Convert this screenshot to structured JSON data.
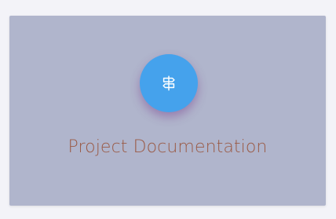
{
  "card": {
    "title": "Project Documentation",
    "icon": "signpost-icon",
    "background_color": "#b0b5cc",
    "icon_bg_color": "#45a2ec",
    "title_color": "#9a5a45"
  }
}
